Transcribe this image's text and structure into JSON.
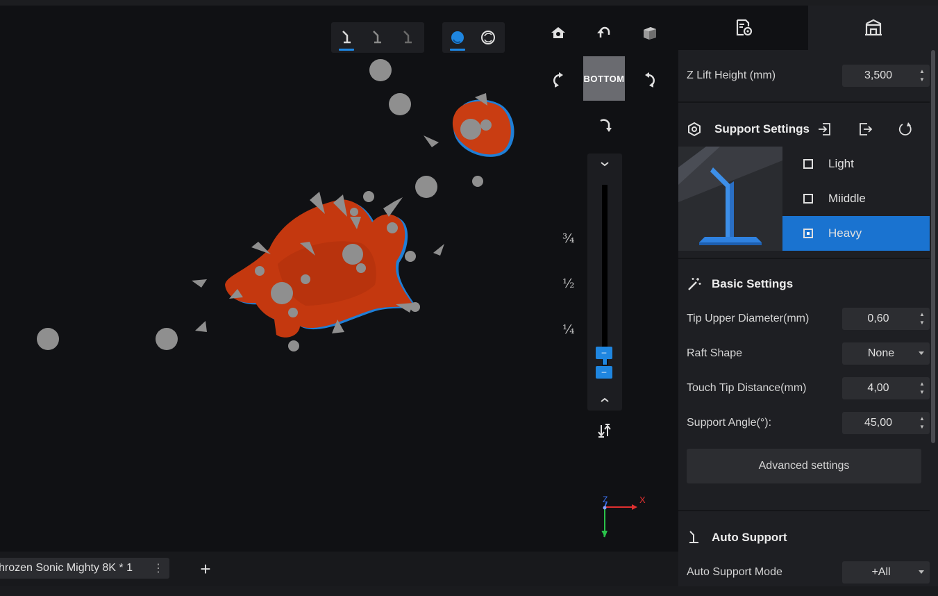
{
  "viewport": {
    "toolbar": {
      "support_tools": [
        "support-tool-1",
        "support-tool-2",
        "support-tool-3"
      ],
      "render_modes": [
        "solid-shading",
        "xray-shading"
      ]
    },
    "viewcube": {
      "face_label": "BOTTOM"
    },
    "nav": [
      "home-view",
      "undo-rotate",
      "perspective-cube",
      "rotate-left",
      "rotate-right",
      "rotate-down"
    ],
    "layer_slider": {
      "fractions": [
        "¾",
        "½",
        "¼"
      ],
      "handle_labels": [
        "–",
        "–"
      ]
    },
    "axes": {
      "x": "X",
      "y": "Y",
      "z": "Z"
    }
  },
  "bottom_bar": {
    "file_tab_label": "hrozen Sonic Mighty 8K * 1",
    "kebab": "⋮",
    "add_label": "+"
  },
  "panel": {
    "tabs": [
      "print-settings-tab",
      "support-tab"
    ],
    "z_lift": {
      "label": "Z Lift Height (mm)",
      "value": "3,500"
    },
    "support_settings": {
      "title": "Support Settings",
      "presets": [
        {
          "label": "Light",
          "selected": false
        },
        {
          "label": "Miiddle",
          "selected": false
        },
        {
          "label": "Heavy",
          "selected": true
        }
      ]
    },
    "basic_settings": {
      "title": "Basic Settings",
      "tip_upper": {
        "label": "Tip Upper Diameter(mm)",
        "value": "0,60"
      },
      "raft_shape": {
        "label": "Raft Shape",
        "value": "None"
      },
      "touch_tip": {
        "label": "Touch Tip Distance(mm)",
        "value": "4,00"
      },
      "support_angle": {
        "label": "Support Angle(°):",
        "value": "45,00"
      },
      "advanced_label": "Advanced settings"
    },
    "auto_support": {
      "title": "Auto Support",
      "mode": {
        "label": "Auto Support Mode",
        "value": "+All"
      }
    },
    "colors": {
      "accent": "#1a73d0",
      "model": "#c93d12",
      "support": "#8f8f8f"
    }
  }
}
